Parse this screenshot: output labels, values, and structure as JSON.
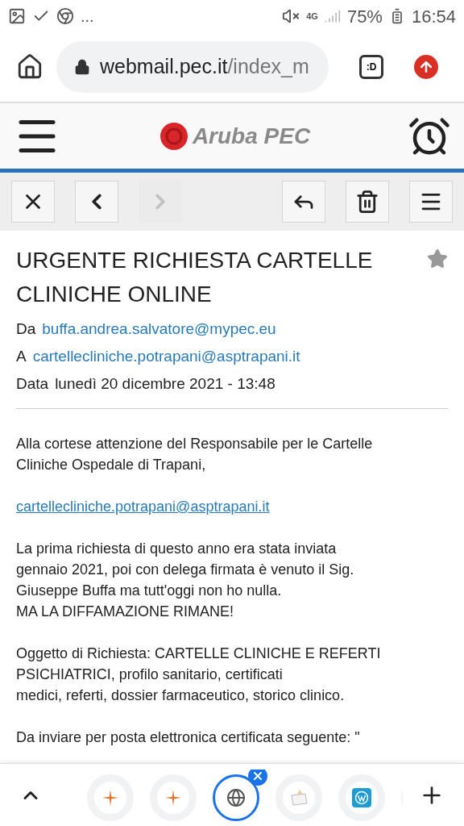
{
  "status_bar": {
    "more": "...",
    "battery": "75%",
    "network": "4G",
    "time": "16:54"
  },
  "browser": {
    "url_host": "webmail.pec.it",
    "url_path": "/index_m",
    "tab_switcher": ":D"
  },
  "header": {
    "logo": "Aruba PEC"
  },
  "toolbar": {
    "left": [
      {
        "kind": "close",
        "disabled": false
      },
      {
        "kind": "prev",
        "disabled": false
      },
      {
        "kind": "next",
        "disabled": true
      }
    ],
    "right": [
      {
        "kind": "reply",
        "disabled": false
      },
      {
        "kind": "delete",
        "disabled": false
      },
      {
        "kind": "menu",
        "disabled": false
      }
    ]
  },
  "message": {
    "subject": "URGENTE RICHIESTA CARTELLE CLINICHE ONLINE",
    "starred": false,
    "fields": [
      {
        "label": "Da",
        "value": "buffa.andrea.salvatore@mypec.eu"
      },
      {
        "label": "A",
        "value": "cartellecliniche.potrapani@asptrapani.it"
      },
      {
        "label": "Data",
        "value": "lunedì 20 dicembre 2021 - 13:48"
      }
    ],
    "body": [
      {
        "kind": "text",
        "lines": [
          "Alla cortese attenzione del Responsabile per le Cartelle",
          "Cliniche Ospedale di Trapani,"
        ]
      },
      {
        "kind": "link",
        "lines": [
          "cartellecliniche.potrapani@asptrapani.it"
        ]
      },
      {
        "kind": "text",
        "lines": [
          "La prima richiesta di questo anno era stata inviata",
          "gennaio 2021, poi con delega firmata è venuto il Sig.",
          "Giuseppe Buffa ma tutt'oggi non ho nulla.",
          "MA LA DIFFAMAZIONE RIMANE!"
        ]
      },
      {
        "kind": "text",
        "lines": [
          "Oggetto di Richiesta: CARTELLE CLINICHE E REFERTI",
          "PSICHIATRICI, profilo sanitario, certificati",
          "medici, referti, dossier farmaceutico, storico clinico."
        ]
      },
      {
        "kind": "text",
        "lines": [
          "Da inviare per posta elettronica certificata seguente: \""
        ]
      }
    ]
  },
  "tabs": [
    {
      "kind": "star",
      "selected": false
    },
    {
      "kind": "star",
      "selected": false
    },
    {
      "kind": "globe",
      "selected": true
    },
    {
      "kind": "wallet",
      "selected": false
    },
    {
      "kind": "wordpress",
      "selected": false
    },
    {
      "kind": "partial",
      "selected": false
    }
  ]
}
